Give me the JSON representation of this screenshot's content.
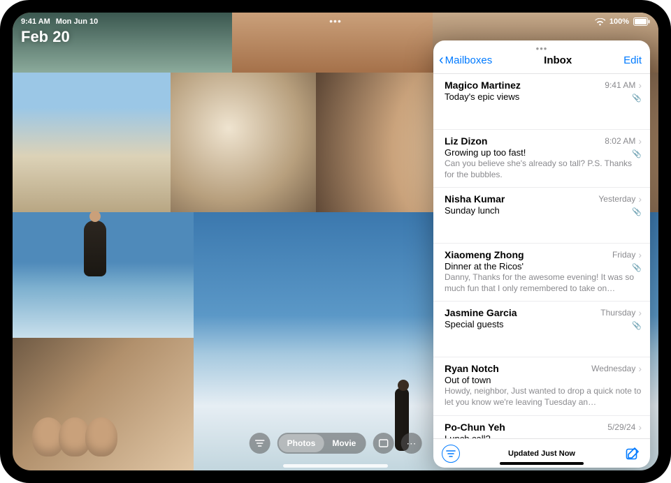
{
  "status_bar": {
    "time": "9:41 AM",
    "date": "Mon Jun 10",
    "battery_pct": "100%"
  },
  "photos": {
    "date_label": "Feb 20",
    "toolbar": {
      "photos_label": "Photos",
      "movie_label": "Movie"
    }
  },
  "mail": {
    "back_label": "Mailboxes",
    "title": "Inbox",
    "edit_label": "Edit",
    "footer_status": "Updated Just Now",
    "items": [
      {
        "sender": "Magico Martinez",
        "time": "9:41 AM",
        "subject": "Today's epic views",
        "preview": "",
        "has_attachment": true
      },
      {
        "sender": "Liz Dizon",
        "time": "8:02 AM",
        "subject": "Growing up too fast!",
        "preview": "Can you believe she's already so tall? P.S. Thanks for the bubbles.",
        "has_attachment": true
      },
      {
        "sender": "Nisha Kumar",
        "time": "Yesterday",
        "subject": "Sunday lunch",
        "preview": "",
        "has_attachment": true
      },
      {
        "sender": "Xiaomeng Zhong",
        "time": "Friday",
        "subject": "Dinner at the Ricos'",
        "preview": "Danny, Thanks for the awesome evening! It was so much fun that I only remembered to take on…",
        "has_attachment": true
      },
      {
        "sender": "Jasmine Garcia",
        "time": "Thursday",
        "subject": "Special guests",
        "preview": "",
        "has_attachment": true
      },
      {
        "sender": "Ryan Notch",
        "time": "Wednesday",
        "subject": "Out of town",
        "preview": "Howdy, neighbor, Just wanted to drop a quick note to let you know we're leaving Tuesday an…",
        "has_attachment": false
      },
      {
        "sender": "Po-Chun Yeh",
        "time": "5/29/24",
        "subject": "Lunch call?",
        "preview": "",
        "has_attachment": false
      }
    ]
  }
}
